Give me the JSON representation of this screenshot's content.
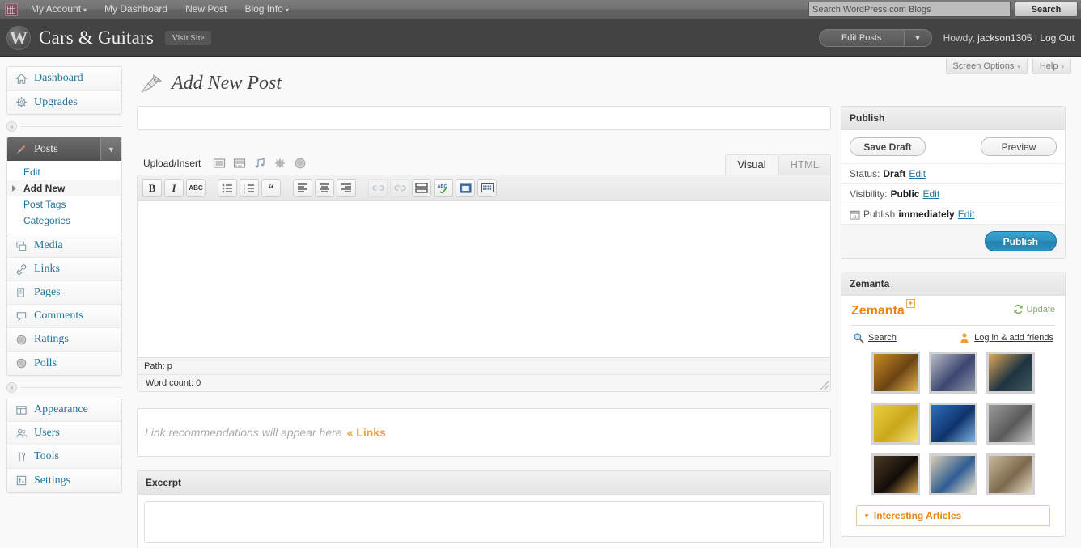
{
  "adminbar": {
    "logo_icon": "wordpress-grid-icon",
    "items": [
      {
        "label": "My Account",
        "caret": "▾"
      },
      {
        "label": "My Dashboard",
        "caret": ""
      },
      {
        "label": "New Post",
        "caret": ""
      },
      {
        "label": "Blog Info",
        "caret": "▾"
      }
    ],
    "search_placeholder": "Search WordPress.com Blogs",
    "search_value": "",
    "search_button": "Search"
  },
  "header": {
    "site_title": "Cars & Guitars",
    "visit_site": "Visit Site",
    "wp_mark": "W",
    "edit_posts_label": "Edit Posts",
    "edit_posts_caret": "▼",
    "howdy_prefix": "Howdy,",
    "username": "jackson1305",
    "separator": "|",
    "logout": "Log Out"
  },
  "screen_meta": {
    "screen_options": "Screen Options",
    "help": "Help",
    "caret": "▾"
  },
  "page": {
    "title": "Add New Post",
    "title_icon": "pushpin-icon"
  },
  "sidebar": {
    "group1": [
      {
        "label": "Dashboard",
        "icon": "home-icon"
      },
      {
        "label": "Upgrades",
        "icon": "gear-icon"
      }
    ],
    "posts": {
      "label": "Posts",
      "icon": "pushpin-icon",
      "dropdown_caret": "▼",
      "submenu": [
        {
          "label": "Edit",
          "current": false
        },
        {
          "label": "Add New",
          "current": true
        },
        {
          "label": "Post Tags",
          "current": false
        },
        {
          "label": "Categories",
          "current": false
        }
      ]
    },
    "group2": [
      {
        "label": "Media",
        "icon": "media-icon"
      },
      {
        "label": "Links",
        "icon": "link-icon"
      },
      {
        "label": "Pages",
        "icon": "pages-icon"
      },
      {
        "label": "Comments",
        "icon": "comment-icon"
      },
      {
        "label": "Ratings",
        "icon": "circle-icon"
      },
      {
        "label": "Polls",
        "icon": "circle-icon"
      }
    ],
    "group3": [
      {
        "label": "Appearance",
        "icon": "appearance-icon"
      },
      {
        "label": "Users",
        "icon": "users-icon"
      },
      {
        "label": "Tools",
        "icon": "tools-icon"
      },
      {
        "label": "Settings",
        "icon": "settings-icon"
      }
    ],
    "collapse_glyph": "«"
  },
  "editor": {
    "title_placeholder": "",
    "title_value": "",
    "upload_insert_label": "Upload/Insert",
    "media_buttons": [
      {
        "name": "add-image-icon"
      },
      {
        "name": "add-video-icon"
      },
      {
        "name": "add-audio-icon"
      },
      {
        "name": "add-media-icon"
      },
      {
        "name": "add-poll-icon"
      }
    ],
    "tabs": [
      {
        "label": "Visual",
        "active": true
      },
      {
        "label": "HTML",
        "active": false
      }
    ],
    "toolbar": [
      {
        "name": "bold-icon",
        "glyph": "B",
        "cls": "bold",
        "disabled": false
      },
      {
        "name": "italic-icon",
        "glyph": "I",
        "cls": "ital",
        "disabled": false
      },
      {
        "name": "strikethrough-icon",
        "glyph": "ABC",
        "cls": "strike",
        "disabled": false
      },
      {
        "name": "bulleted-list-icon",
        "glyph": "",
        "cls": "svg-ul",
        "disabled": false
      },
      {
        "name": "numbered-list-icon",
        "glyph": "",
        "cls": "svg-ol",
        "disabled": false
      },
      {
        "name": "blockquote-icon",
        "glyph": "“",
        "cls": "quote",
        "disabled": false
      },
      {
        "name": "align-left-icon",
        "glyph": "",
        "cls": "svg-al",
        "disabled": false
      },
      {
        "name": "align-center-icon",
        "glyph": "",
        "cls": "svg-ac",
        "disabled": false
      },
      {
        "name": "align-right-icon",
        "glyph": "",
        "cls": "svg-ar",
        "disabled": false
      },
      {
        "name": "insert-link-icon",
        "glyph": "",
        "cls": "svg-link",
        "disabled": true
      },
      {
        "name": "unlink-icon",
        "glyph": "",
        "cls": "svg-unlink",
        "disabled": true
      },
      {
        "name": "insert-more-tag-icon",
        "glyph": "",
        "cls": "svg-more",
        "disabled": false
      },
      {
        "name": "spellcheck-icon",
        "glyph": "",
        "cls": "svg-spell",
        "disabled": false
      },
      {
        "name": "fullscreen-icon",
        "glyph": "",
        "cls": "svg-full",
        "disabled": false
      },
      {
        "name": "kitchen-sink-icon",
        "glyph": "",
        "cls": "svg-sink",
        "disabled": false
      }
    ],
    "path_label": "Path: p",
    "word_count_label": "Word count: 0"
  },
  "link_reco": {
    "text": "Link recommendations will appear here",
    "chevrons": "«",
    "link_label": "Links"
  },
  "excerpt": {
    "title": "Excerpt",
    "value": "",
    "placeholder": ""
  },
  "publish": {
    "title": "Publish",
    "save_draft_label": "Save Draft",
    "preview_label": "Preview",
    "rows": [
      {
        "label": "Status:",
        "value": "Draft",
        "edit": "Edit",
        "icon": ""
      },
      {
        "label": "Visibility:",
        "value": "Public",
        "edit": "Edit",
        "icon": ""
      },
      {
        "label": "Publish",
        "value": "immediately",
        "edit": "Edit",
        "icon": "calendar-icon"
      }
    ],
    "publish_button": "Publish",
    "accent_color": "#2e90bb"
  },
  "zemanta": {
    "title": "Zemanta",
    "logo_text": "Zemanta",
    "logo_plus": "+",
    "logo_color": "#f0820c",
    "update_label": "Update",
    "update_icon": "refresh-icon",
    "search_label": "Search",
    "search_icon": "magnifier-icon",
    "friends_label": "Log in & add friends",
    "friends_icon": "person-icon",
    "thumbnails": [
      {
        "name": "thumb-rusty-machine",
        "c1": "#c98a24",
        "c2": "#6b4412",
        "c3": "#e0b055"
      },
      {
        "name": "thumb-stadium-crowd",
        "c1": "#b9bcc6",
        "c2": "#3c4670",
        "c3": "#8d93a8"
      },
      {
        "name": "thumb-sunset-field",
        "c1": "#e0a85a",
        "c2": "#1d3340",
        "c3": "#3f5a5c"
      },
      {
        "name": "thumb-yellow-texture",
        "c1": "#e8cf3c",
        "c2": "#c9a81b",
        "c3": "#f2e377"
      },
      {
        "name": "thumb-blue-skyscraper",
        "c1": "#2d6fbe",
        "c2": "#10336b",
        "c3": "#7fb3e6"
      },
      {
        "name": "thumb-gray-branch",
        "c1": "#9b9b9b",
        "c2": "#5a5a5a",
        "c3": "#c4c4c4"
      },
      {
        "name": "thumb-pier-sunset",
        "c1": "#4a3a26",
        "c2": "#120d08",
        "c3": "#d9a24e"
      },
      {
        "name": "thumb-boat-sail",
        "c1": "#d8cdb2",
        "c2": "#2f5d93",
        "c3": "#efe6cf"
      },
      {
        "name": "thumb-cat-face",
        "c1": "#c9b89a",
        "c2": "#7d6a4d",
        "c3": "#e8ddc6"
      }
    ],
    "articles_label": "Interesting Articles",
    "articles_caret": "▼"
  }
}
